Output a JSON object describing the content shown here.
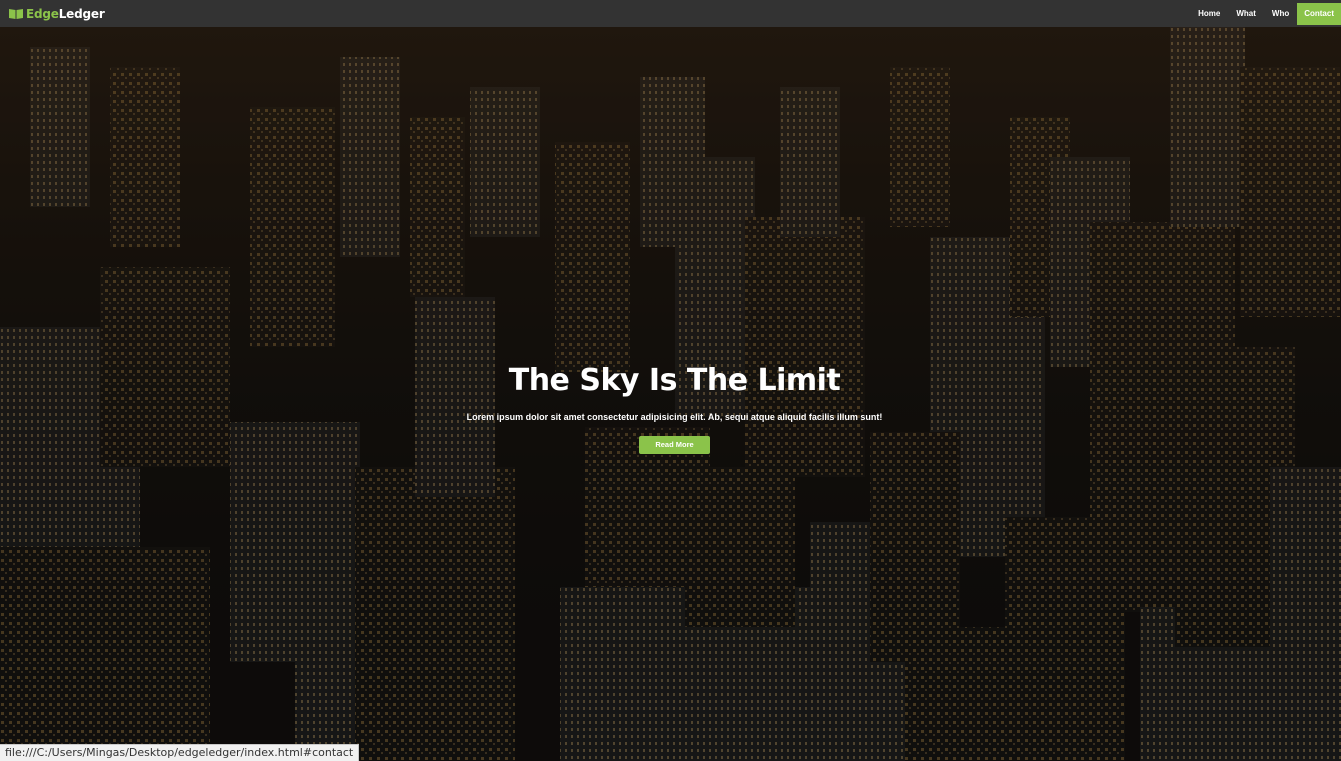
{
  "navbar": {
    "brand_accent": "Edge",
    "brand_rest": "Ledger",
    "brand_icon": "book-icon",
    "links": [
      {
        "label": "Home"
      },
      {
        "label": "What"
      },
      {
        "label": "Who"
      },
      {
        "label": "Contact",
        "active": true
      }
    ]
  },
  "hero": {
    "title": "The Sky Is The Limit",
    "subtitle": "Lorem ipsum dolor sit amet consectetur adipisicing elit. Ab, sequi atque aliquid facilis illum sunt!",
    "button_label": "Read More",
    "background": "night-city-aerial-photo"
  },
  "statusbar": {
    "url": "file:///C:/Users/Mingas/Desktop/edgeledger/index.html#contact"
  },
  "colors": {
    "accent": "#8bc34a",
    "navbar_bg": "#333333",
    "text": "#ffffff"
  }
}
